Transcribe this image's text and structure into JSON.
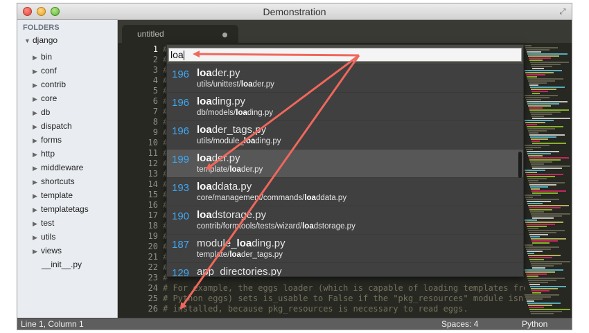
{
  "window": {
    "title": "Demonstration"
  },
  "sidebar": {
    "header": "FOLDERS",
    "root": "django",
    "items": [
      {
        "label": "bin",
        "type": "folder"
      },
      {
        "label": "conf",
        "type": "folder"
      },
      {
        "label": "contrib",
        "type": "folder"
      },
      {
        "label": "core",
        "type": "folder"
      },
      {
        "label": "db",
        "type": "folder"
      },
      {
        "label": "dispatch",
        "type": "folder"
      },
      {
        "label": "forms",
        "type": "folder"
      },
      {
        "label": "http",
        "type": "folder"
      },
      {
        "label": "middleware",
        "type": "folder"
      },
      {
        "label": "shortcuts",
        "type": "folder"
      },
      {
        "label": "template",
        "type": "folder"
      },
      {
        "label": "templatetags",
        "type": "folder"
      },
      {
        "label": "test",
        "type": "folder"
      },
      {
        "label": "utils",
        "type": "folder"
      },
      {
        "label": "views",
        "type": "folder"
      },
      {
        "label": "__init__.py",
        "type": "file"
      }
    ]
  },
  "tab": {
    "label": "untitled"
  },
  "gutter": {
    "lines": [
      "1",
      "2",
      "3",
      "4",
      "5",
      "6",
      "7",
      "8",
      "9",
      "10",
      "11",
      "12",
      "13",
      "14",
      "15",
      "16",
      "17",
      "18",
      "19",
      "20",
      "21",
      "22",
      "23",
      "24",
      "25",
      "26"
    ]
  },
  "code": {
    "lines": [
      "#",
      "#",
      "#",
      "#",
      "#",
      "#",
      "#",
      "#",
      "#",
      "#",
      "#",
      "#",
      "#",
      "#",
      "#",
      "#",
      "#",
      "#",
      "#",
      "#",
      "#",
      "#",
      "#",
      "# For example, the eggs loader (which is capable of loading templates from",
      "# Python eggs) sets is_usable to False if the \"pkg_resources\" module isn't",
      "# installed, because pkg_resources is necessary to read eggs."
    ]
  },
  "palette": {
    "query": "loa",
    "results": [
      {
        "score": "196",
        "match": "loa",
        "name_rest": "der.py",
        "name_prefix": "",
        "path_pre": "utils/unittest/",
        "path_match": "loa",
        "path_post": "der.py",
        "selected": false
      },
      {
        "score": "196",
        "match": "loa",
        "name_rest": "ding.py",
        "name_prefix": "",
        "path_pre": "db/models/",
        "path_match": "loa",
        "path_post": "ding.py",
        "selected": false
      },
      {
        "score": "196",
        "match": "loa",
        "name_rest": "der_tags.py",
        "name_prefix": "",
        "path_pre": "utils/module_",
        "path_match": "loa",
        "path_post": "ding.py",
        "selected": false
      },
      {
        "score": "199",
        "match": "loa",
        "name_rest": "der.py",
        "name_prefix": "",
        "path_pre": "template/",
        "path_match": "loa",
        "path_post": "der.py",
        "selected": true
      },
      {
        "score": "193",
        "match": "loa",
        "name_rest": "ddata.py",
        "name_prefix": "",
        "path_pre": "core/management/commands/",
        "path_match": "loa",
        "path_post": "ddata.py",
        "selected": false
      },
      {
        "score": "190",
        "match": "loa",
        "name_rest": "dstorage.py",
        "name_prefix": "",
        "path_pre": "contrib/formtools/tests/wizard/",
        "path_match": "loa",
        "path_post": "dstorage.py",
        "selected": false
      },
      {
        "score": "187",
        "match": "loa",
        "name_rest": "ding.py",
        "name_prefix": "module_",
        "path_pre": "template/",
        "path_match": "loa",
        "path_post": "der_tags.py",
        "selected": false
      },
      {
        "score": "129",
        "match": "",
        "name_rest": "app_directories.py",
        "name_prefix": "",
        "path_pre": "",
        "path_match": "",
        "path_post": "",
        "selected": false
      }
    ]
  },
  "status": {
    "position": "Line 1, Column 1",
    "indent": "Spaces: 4",
    "syntax": "Python"
  },
  "colors": {
    "annotation_arrow": "#f0675b",
    "score": "#3fa9f5",
    "editor_bg": "#272822"
  }
}
